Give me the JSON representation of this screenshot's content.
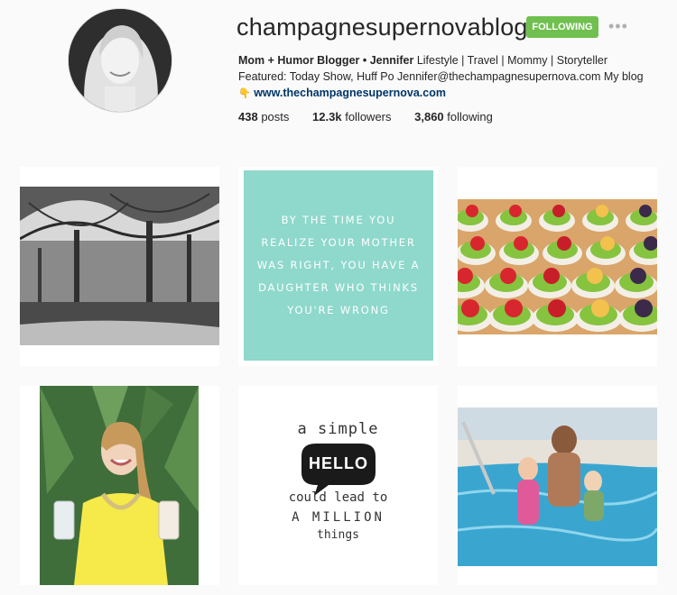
{
  "profile": {
    "username": "champagnesupernovablog",
    "follow_button": "FOLLOWING",
    "more_icon": "•••",
    "bio_bold": "Mom + Humor Blogger • Jennifer",
    "bio_line1_rest": " Lifestyle | Travel | Mommy | Storyteller",
    "bio_line2": "Featured: Today Show, Huff Po Jennifer@thechampagnesupernova.com My blog",
    "pointer_emoji": "👇",
    "website": "www.thechampagnesupernova.com"
  },
  "stats": {
    "posts_count": "438",
    "posts_label": "posts",
    "followers_count": "12.3k",
    "followers_label": "followers",
    "following_count": "3,860",
    "following_label": "following"
  },
  "posts": {
    "quote_text": [
      "BY THE TIME YOU",
      "REALIZE YOUR MOTHER",
      "WAS RIGHT, YOU HAVE A",
      "DAUGHTER WHO THINKS",
      "YOU'RE WRONG"
    ],
    "hello_line1": "a simple",
    "hello_word": "HELLO",
    "hello_line3": "could lead to",
    "hello_line4": "A MILLION",
    "hello_line5": "things"
  },
  "colors": {
    "follow_green": "#70c050",
    "link_blue": "#003569",
    "quote_teal": "#8fd8cc"
  }
}
